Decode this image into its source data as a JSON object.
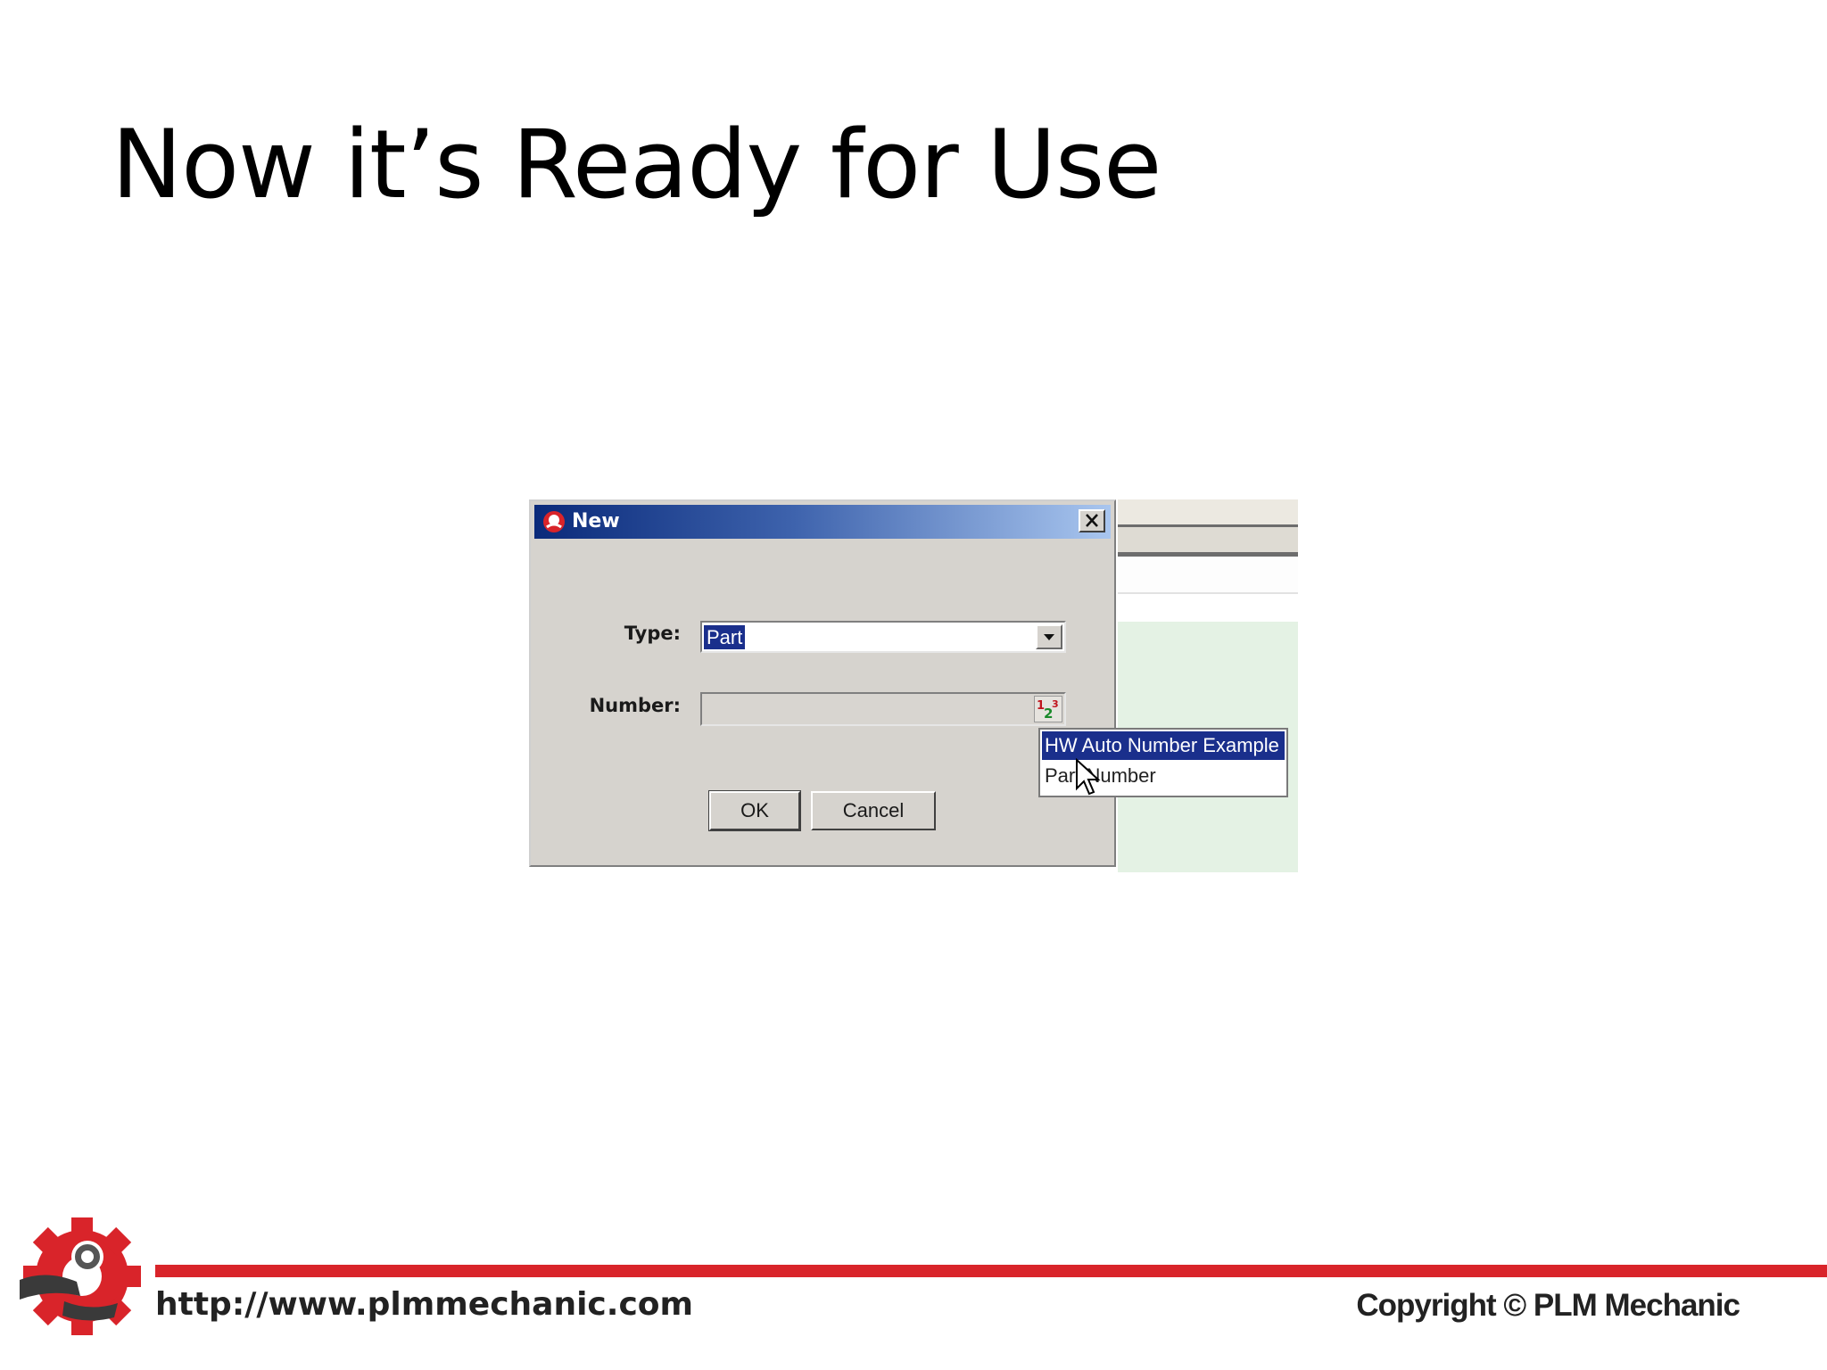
{
  "slide": {
    "title": "Now it’s Ready for Use"
  },
  "dialog": {
    "title": "New",
    "type_label": "Type:",
    "type_value": "Part",
    "number_label": "Number:",
    "number_value": "",
    "ok_label": "OK",
    "cancel_label": "Cancel"
  },
  "popup": {
    "items": [
      {
        "label": "HW Auto Number Example",
        "selected": true
      },
      {
        "label": "Part Number",
        "selected": false
      }
    ]
  },
  "icons": {
    "app": "app-logo-icon",
    "close": "close-icon",
    "dropdown": "chevron-down-icon",
    "autonumber": "auto-number-icon",
    "cursor": "mouse-cursor-icon",
    "logo": "plm-mechanic-gear-logo"
  },
  "footer": {
    "url": "http://www.plmmechanic.com",
    "copyright": "Copyright © PLM Mechanic"
  },
  "colors": {
    "selection": "#1a2f8c",
    "accent_red": "#d9242a",
    "dialog_bg": "#d6d3ce"
  }
}
